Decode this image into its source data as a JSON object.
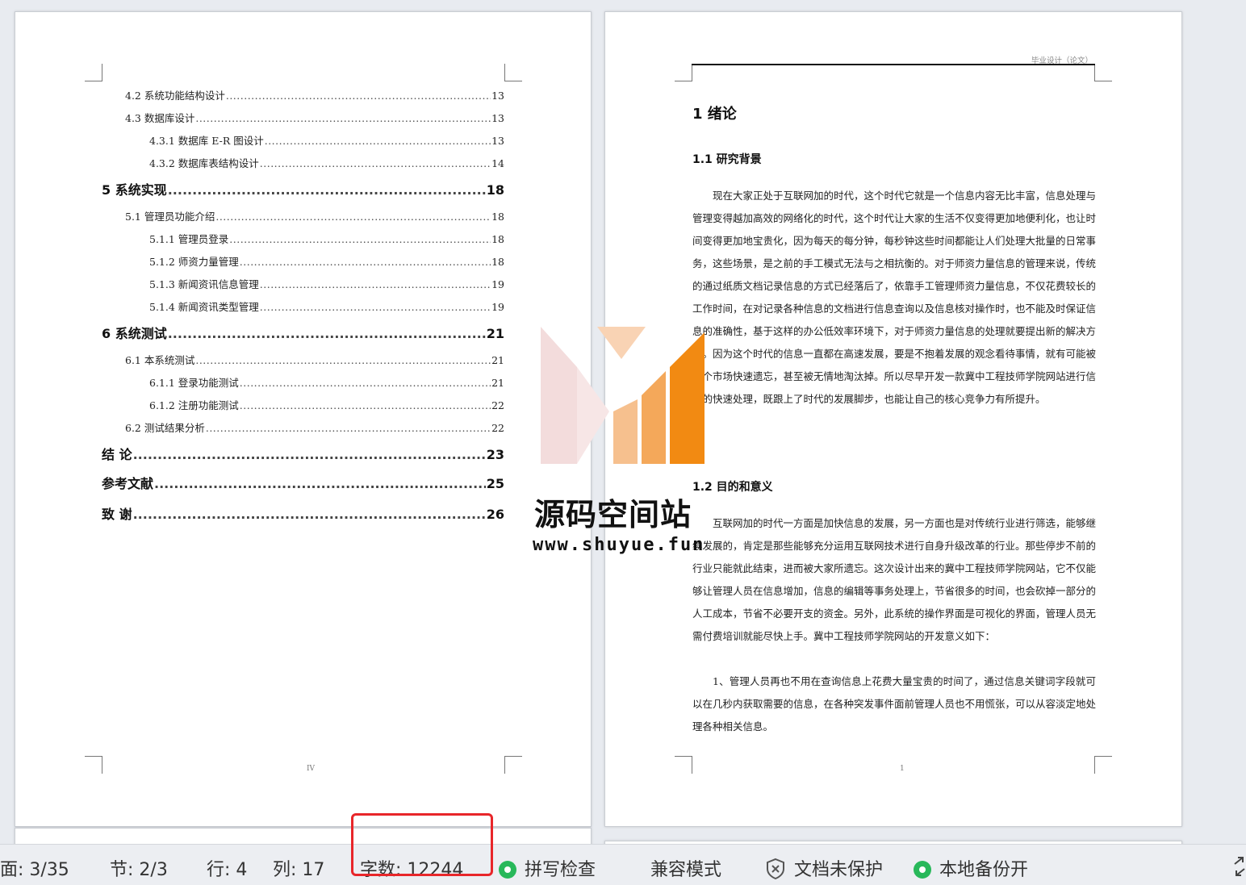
{
  "left_page": {
    "toc": [
      {
        "text": "4.2 系统功能结构设计",
        "page": "13",
        "level": 2
      },
      {
        "text": "4.3 数据库设计",
        "page": "13",
        "level": 2
      },
      {
        "text": "4.3.1 数据库 E-R 图设计",
        "page": "13",
        "level": 3
      },
      {
        "text": "4.3.2  数据库表结构设计",
        "page": "14",
        "level": 3
      },
      {
        "text": "5  系统实现",
        "page": "18",
        "level": 1
      },
      {
        "text": "5.1 管理员功能介绍",
        "page": "18",
        "level": 2
      },
      {
        "text": "5.1.1 管理员登录",
        "page": "18",
        "level": 3
      },
      {
        "text": "5.1.2  师资力量管理",
        "page": "18",
        "level": 3
      },
      {
        "text": "5.1.3  新闻资讯信息管理",
        "page": "19",
        "level": 3
      },
      {
        "text": "5.1.4 新闻资讯类型管理",
        "page": "19",
        "level": 3
      },
      {
        "text": "6 系统测试",
        "page": "21",
        "level": 1
      },
      {
        "text": "6.1  本系统测试",
        "page": "21",
        "level": 2
      },
      {
        "text": "6.1.1  登录功能测试",
        "page": "21",
        "level": 3
      },
      {
        "text": "6.1.2  注册功能测试",
        "page": "22",
        "level": 3
      },
      {
        "text": "6.2 测试结果分析",
        "page": "22",
        "level": 2
      },
      {
        "text": "结   论",
        "page": "23",
        "level": 1
      },
      {
        "text": "参考文献",
        "page": "25",
        "level": 1
      },
      {
        "text": "致   谢",
        "page": "26",
        "level": 1
      }
    ],
    "page_number": "IV"
  },
  "right_page": {
    "header": "毕业设计（论文）",
    "h1": "1  绪论",
    "h2_1": "1.1  研究背景",
    "para_1": "现在大家正处于互联网加的时代，这个时代它就是一个信息内容无比丰富，信息处理与管理变得越加高效的网络化的时代，这个时代让大家的生活不仅变得更加地便利化，也让时间变得更加地宝贵化，因为每天的每分钟，每秒钟这些时间都能让人们处理大批量的日常事务，这些场景，是之前的手工模式无法与之相抗衡的。对于师资力量信息的管理来说，传统的通过纸质文档记录信息的方式已经落后了，依靠手工管理师资力量信息，不仅花费较长的工作时间，在对记录各种信息的文档进行信息查询以及信息核对操作时，也不能及时保证信息的准确性，基于这样的办公低效率环境下，对于师资力量信息的处理就要提出新的解决方案。因为这个时代的信息一直都在高速发展，要是不抱着发展的观念看待事情，就有可能被这个市场快速遗忘，甚至被无情地淘汰掉。所以尽早开发一款冀中工程技师学院网站进行信息的快速处理，既跟上了时代的发展脚步，也能让自己的核心竞争力有所提升。",
    "h2_2": "1.2 目的和意义",
    "para_2": "互联网加的时代一方面是加快信息的发展，另一方面也是对传统行业进行筛选，能够继续发展的，肯定是那些能够充分运用互联网技术进行自身升级改革的行业。那些停步不前的行业只能就此结束，进而被大家所遗忘。这次设计出来的冀中工程技师学院网站，它不仅能够让管理人员在信息增加，信息的编辑等事务处理上，节省很多的时间，也会砍掉一部分的人工成本，节省不必要开支的资金。另外，此系统的操作界面是可视化的界面，管理人员无需付费培训就能尽快上手。冀中工程技师学院网站的开发意义如下：",
    "para_3": "1、管理人员再也不用在查询信息上花费大量宝贵的时间了，通过信息关键词字段就可以在几秒内获取需要的信息，在各种突发事件面前管理人员也不用慌张，可以从容淡定地处理各种相关信息。",
    "page_number": "1"
  },
  "watermark": {
    "title": "源码空间站",
    "url": "www.shuyue.fun"
  },
  "status_bar": {
    "page": "面: 3/35",
    "section": "节: 2/3",
    "row": "行: 4",
    "col": "列: 17",
    "word_count": "字数: 12244",
    "spell_check": "拼写检查",
    "compat_mode": "兼容模式",
    "doc_protect": "文档未保护",
    "local_backup": "本地备份开"
  },
  "colors": {
    "highlight": "#e8262a",
    "status_ok": "#28b85a",
    "logo_orange": "#f28a12"
  }
}
